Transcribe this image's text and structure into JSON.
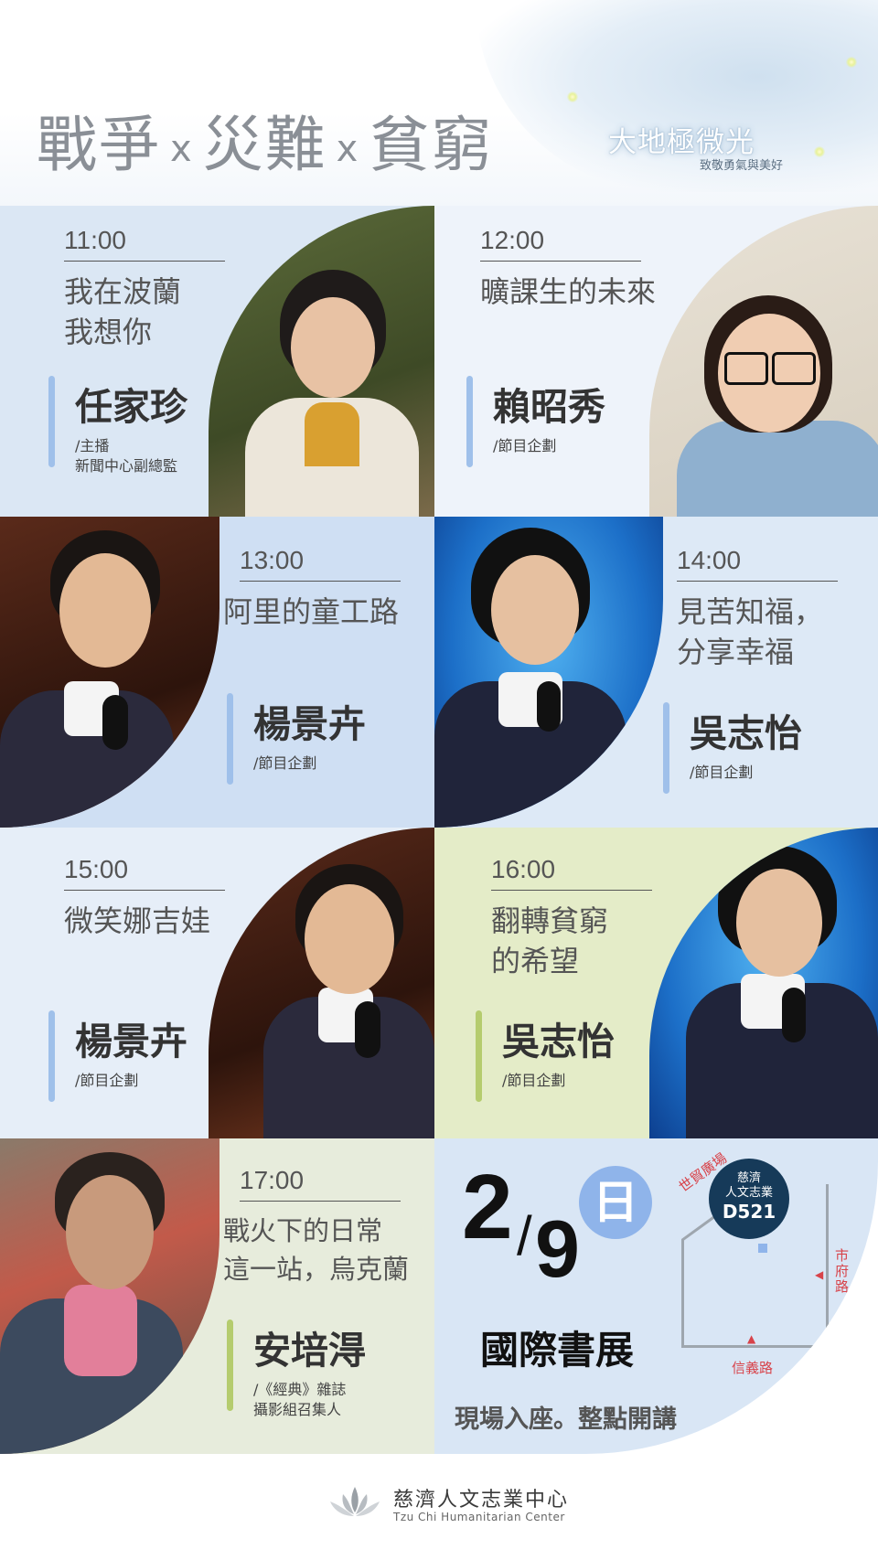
{
  "header": {
    "title_parts": [
      "戰爭",
      "x",
      "災難",
      "x",
      "貧窮"
    ],
    "logo_title": "大地極微光",
    "logo_subtitle": "致敬勇氣與美好"
  },
  "sessions": [
    {
      "time": "11:00",
      "title_lines": [
        "我在波蘭",
        "我想你"
      ],
      "speaker": "任家珍",
      "role_lines": [
        "/主播",
        "新聞中心副總監"
      ]
    },
    {
      "time": "12:00",
      "title_lines": [
        "曠課生的未來"
      ],
      "speaker": "賴昭秀",
      "role_lines": [
        "/節目企劃"
      ]
    },
    {
      "time": "13:00",
      "title_lines": [
        "阿里的童工路"
      ],
      "speaker": "楊景卉",
      "role_lines": [
        "/節目企劃"
      ]
    },
    {
      "time": "14:00",
      "title_lines": [
        "見苦知福，",
        "分享幸福"
      ],
      "speaker": "吳志怡",
      "role_lines": [
        "/節目企劃"
      ]
    },
    {
      "time": "15:00",
      "title_lines": [
        "微笑娜吉娃"
      ],
      "speaker": "楊景卉",
      "role_lines": [
        "/節目企劃"
      ]
    },
    {
      "time": "16:00",
      "title_lines": [
        "翻轉貧窮",
        "的希望"
      ],
      "speaker": "吳志怡",
      "role_lines": [
        "/節目企劃"
      ]
    },
    {
      "time": "17:00",
      "title_lines": [
        "戰火下的日常",
        "這一站，烏克蘭"
      ],
      "speaker": "安培淂",
      "role_lines": [
        "/《經典》雜誌",
        "攝影組召集人"
      ]
    }
  ],
  "event": {
    "month": "2",
    "slash": "/",
    "day": "9",
    "weekday": "日",
    "name": "國際書展",
    "note": "現場入座。整點開講",
    "map": {
      "booth_line1": "慈濟",
      "booth_line2": "人文志業",
      "booth_code": "D521",
      "entrance_top": "世貿廣場",
      "entrance_right": "市府路",
      "entrance_bottom": "信義路"
    }
  },
  "footer": {
    "org_name": "慈濟人文志業中心",
    "org_name_en": "Tzu Chi Humanitarian Center"
  },
  "colors": {
    "accent_blue": "#9fc0ea",
    "accent_green": "#b5cc6e",
    "pin_navy": "#163a59",
    "map_red": "#d8434a"
  }
}
